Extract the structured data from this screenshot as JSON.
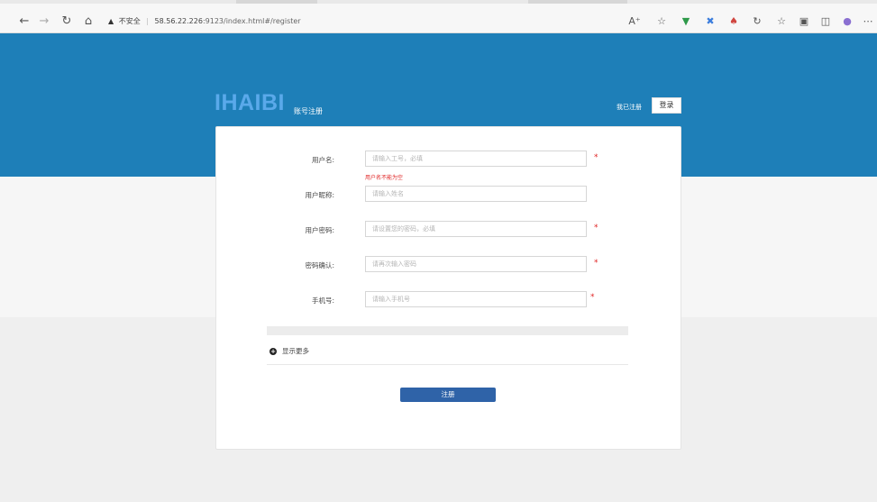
{
  "browser": {
    "security_label": "不安全",
    "url_host": "58.56.22.226",
    "url_rest": ":9123/index.html#/register",
    "icons": [
      "back-icon",
      "forward-icon",
      "refresh-icon",
      "home-icon",
      "warning-icon",
      "read-aloud-icon",
      "favorites-icon",
      "extension-shield-icon",
      "extension-leaf-icon",
      "extension-color-icon",
      "extension-c-icon",
      "favorites-bar-icon",
      "collections-icon",
      "feedback-icon",
      "profile-icon",
      "more-icon"
    ]
  },
  "header": {
    "logo": "IHAIBI",
    "subtitle": "账号注册",
    "have_account": "我已注册",
    "login_button": "登录"
  },
  "form": {
    "username": {
      "label": "用户名:",
      "placeholder": "请输入工号，必填",
      "required": "*",
      "error": "用户名不能为空"
    },
    "nickname": {
      "label": "用户昵称:",
      "placeholder": "请输入姓名"
    },
    "password": {
      "label": "用户密码:",
      "placeholder": "请设置您的密码，必填",
      "required": "*"
    },
    "confirm": {
      "label": "密码确认:",
      "placeholder": "请再次输入密码",
      "required": "*"
    },
    "phone": {
      "label": "手机号:",
      "placeholder": "请输入手机号",
      "required": "*"
    },
    "show_more": "显示更多",
    "submit": "注册"
  },
  "colors": {
    "hero": "#1e7fb8",
    "logo": "#5aa9ea",
    "submit": "#2f63a8",
    "error": "#e02424"
  }
}
